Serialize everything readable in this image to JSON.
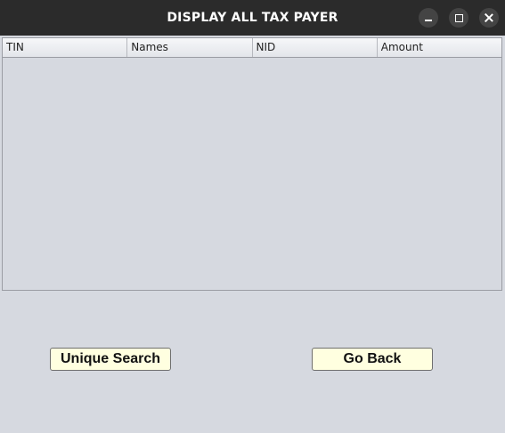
{
  "window": {
    "title": "DISPLAY ALL TAX PAYER",
    "controls": {
      "minimize_icon": "minimize-icon",
      "maximize_icon": "maximize-icon",
      "close_icon": "close-icon"
    }
  },
  "table": {
    "columns": [
      "TIN",
      "Names",
      "NID",
      "Amount"
    ],
    "rows": []
  },
  "buttons": {
    "unique_search": "Unique Search",
    "go_back": "Go Back"
  },
  "colors": {
    "titlebar": "#2b2b2b",
    "background": "#d6d9e0",
    "button_fill": "#ffffe0"
  }
}
